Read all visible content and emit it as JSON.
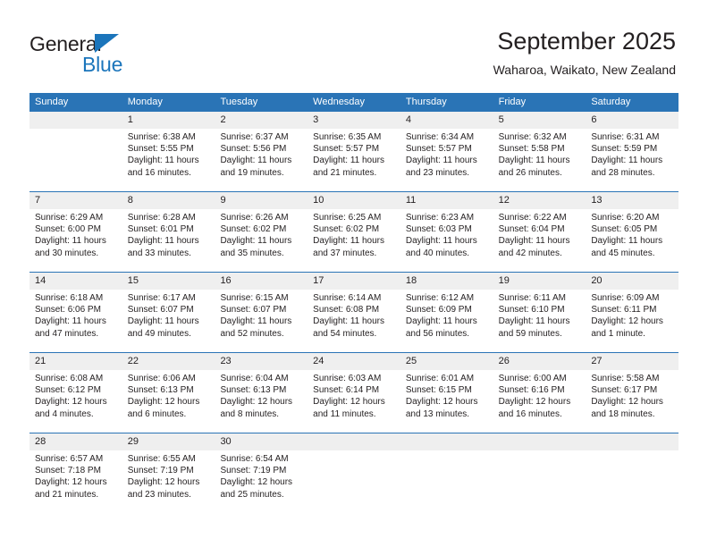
{
  "logo": {
    "primary_text": "General",
    "secondary_text": "Blue",
    "triangle_icon": "triangle-icon",
    "primary_color": "#231f20",
    "accent_color": "#1b75bb"
  },
  "header": {
    "title": "September 2025",
    "subtitle": "Waharoa, Waikato, New Zealand"
  },
  "theme": {
    "header_bg": "#2a74b6",
    "header_text": "#ffffff",
    "daynum_bg": "#efefef",
    "body_text": "#231f20",
    "grid_line": "#2a74b6"
  },
  "weekdays": [
    {
      "label": "Sunday"
    },
    {
      "label": "Monday"
    },
    {
      "label": "Tuesday"
    },
    {
      "label": "Wednesday"
    },
    {
      "label": "Thursday"
    },
    {
      "label": "Friday"
    },
    {
      "label": "Saturday"
    }
  ],
  "weeks": [
    [
      {
        "day": "",
        "empty": true
      },
      {
        "day": "1",
        "sunrise": "Sunrise: 6:38 AM",
        "sunset": "Sunset: 5:55 PM",
        "daylight_1": "Daylight: 11 hours",
        "daylight_2": "and 16 minutes."
      },
      {
        "day": "2",
        "sunrise": "Sunrise: 6:37 AM",
        "sunset": "Sunset: 5:56 PM",
        "daylight_1": "Daylight: 11 hours",
        "daylight_2": "and 19 minutes."
      },
      {
        "day": "3",
        "sunrise": "Sunrise: 6:35 AM",
        "sunset": "Sunset: 5:57 PM",
        "daylight_1": "Daylight: 11 hours",
        "daylight_2": "and 21 minutes."
      },
      {
        "day": "4",
        "sunrise": "Sunrise: 6:34 AM",
        "sunset": "Sunset: 5:57 PM",
        "daylight_1": "Daylight: 11 hours",
        "daylight_2": "and 23 minutes."
      },
      {
        "day": "5",
        "sunrise": "Sunrise: 6:32 AM",
        "sunset": "Sunset: 5:58 PM",
        "daylight_1": "Daylight: 11 hours",
        "daylight_2": "and 26 minutes."
      },
      {
        "day": "6",
        "sunrise": "Sunrise: 6:31 AM",
        "sunset": "Sunset: 5:59 PM",
        "daylight_1": "Daylight: 11 hours",
        "daylight_2": "and 28 minutes."
      }
    ],
    [
      {
        "day": "7",
        "sunrise": "Sunrise: 6:29 AM",
        "sunset": "Sunset: 6:00 PM",
        "daylight_1": "Daylight: 11 hours",
        "daylight_2": "and 30 minutes."
      },
      {
        "day": "8",
        "sunrise": "Sunrise: 6:28 AM",
        "sunset": "Sunset: 6:01 PM",
        "daylight_1": "Daylight: 11 hours",
        "daylight_2": "and 33 minutes."
      },
      {
        "day": "9",
        "sunrise": "Sunrise: 6:26 AM",
        "sunset": "Sunset: 6:02 PM",
        "daylight_1": "Daylight: 11 hours",
        "daylight_2": "and 35 minutes."
      },
      {
        "day": "10",
        "sunrise": "Sunrise: 6:25 AM",
        "sunset": "Sunset: 6:02 PM",
        "daylight_1": "Daylight: 11 hours",
        "daylight_2": "and 37 minutes."
      },
      {
        "day": "11",
        "sunrise": "Sunrise: 6:23 AM",
        "sunset": "Sunset: 6:03 PM",
        "daylight_1": "Daylight: 11 hours",
        "daylight_2": "and 40 minutes."
      },
      {
        "day": "12",
        "sunrise": "Sunrise: 6:22 AM",
        "sunset": "Sunset: 6:04 PM",
        "daylight_1": "Daylight: 11 hours",
        "daylight_2": "and 42 minutes."
      },
      {
        "day": "13",
        "sunrise": "Sunrise: 6:20 AM",
        "sunset": "Sunset: 6:05 PM",
        "daylight_1": "Daylight: 11 hours",
        "daylight_2": "and 45 minutes."
      }
    ],
    [
      {
        "day": "14",
        "sunrise": "Sunrise: 6:18 AM",
        "sunset": "Sunset: 6:06 PM",
        "daylight_1": "Daylight: 11 hours",
        "daylight_2": "and 47 minutes."
      },
      {
        "day": "15",
        "sunrise": "Sunrise: 6:17 AM",
        "sunset": "Sunset: 6:07 PM",
        "daylight_1": "Daylight: 11 hours",
        "daylight_2": "and 49 minutes."
      },
      {
        "day": "16",
        "sunrise": "Sunrise: 6:15 AM",
        "sunset": "Sunset: 6:07 PM",
        "daylight_1": "Daylight: 11 hours",
        "daylight_2": "and 52 minutes."
      },
      {
        "day": "17",
        "sunrise": "Sunrise: 6:14 AM",
        "sunset": "Sunset: 6:08 PM",
        "daylight_1": "Daylight: 11 hours",
        "daylight_2": "and 54 minutes."
      },
      {
        "day": "18",
        "sunrise": "Sunrise: 6:12 AM",
        "sunset": "Sunset: 6:09 PM",
        "daylight_1": "Daylight: 11 hours",
        "daylight_2": "and 56 minutes."
      },
      {
        "day": "19",
        "sunrise": "Sunrise: 6:11 AM",
        "sunset": "Sunset: 6:10 PM",
        "daylight_1": "Daylight: 11 hours",
        "daylight_2": "and 59 minutes."
      },
      {
        "day": "20",
        "sunrise": "Sunrise: 6:09 AM",
        "sunset": "Sunset: 6:11 PM",
        "daylight_1": "Daylight: 12 hours",
        "daylight_2": "and 1 minute."
      }
    ],
    [
      {
        "day": "21",
        "sunrise": "Sunrise: 6:08 AM",
        "sunset": "Sunset: 6:12 PM",
        "daylight_1": "Daylight: 12 hours",
        "daylight_2": "and 4 minutes."
      },
      {
        "day": "22",
        "sunrise": "Sunrise: 6:06 AM",
        "sunset": "Sunset: 6:13 PM",
        "daylight_1": "Daylight: 12 hours",
        "daylight_2": "and 6 minutes."
      },
      {
        "day": "23",
        "sunrise": "Sunrise: 6:04 AM",
        "sunset": "Sunset: 6:13 PM",
        "daylight_1": "Daylight: 12 hours",
        "daylight_2": "and 8 minutes."
      },
      {
        "day": "24",
        "sunrise": "Sunrise: 6:03 AM",
        "sunset": "Sunset: 6:14 PM",
        "daylight_1": "Daylight: 12 hours",
        "daylight_2": "and 11 minutes."
      },
      {
        "day": "25",
        "sunrise": "Sunrise: 6:01 AM",
        "sunset": "Sunset: 6:15 PM",
        "daylight_1": "Daylight: 12 hours",
        "daylight_2": "and 13 minutes."
      },
      {
        "day": "26",
        "sunrise": "Sunrise: 6:00 AM",
        "sunset": "Sunset: 6:16 PM",
        "daylight_1": "Daylight: 12 hours",
        "daylight_2": "and 16 minutes."
      },
      {
        "day": "27",
        "sunrise": "Sunrise: 5:58 AM",
        "sunset": "Sunset: 6:17 PM",
        "daylight_1": "Daylight: 12 hours",
        "daylight_2": "and 18 minutes."
      }
    ],
    [
      {
        "day": "28",
        "sunrise": "Sunrise: 6:57 AM",
        "sunset": "Sunset: 7:18 PM",
        "daylight_1": "Daylight: 12 hours",
        "daylight_2": "and 21 minutes."
      },
      {
        "day": "29",
        "sunrise": "Sunrise: 6:55 AM",
        "sunset": "Sunset: 7:19 PM",
        "daylight_1": "Daylight: 12 hours",
        "daylight_2": "and 23 minutes."
      },
      {
        "day": "30",
        "sunrise": "Sunrise: 6:54 AM",
        "sunset": "Sunset: 7:19 PM",
        "daylight_1": "Daylight: 12 hours",
        "daylight_2": "and 25 minutes."
      },
      {
        "day": "",
        "empty": true
      },
      {
        "day": "",
        "empty": true
      },
      {
        "day": "",
        "empty": true
      },
      {
        "day": "",
        "empty": true
      }
    ]
  ]
}
